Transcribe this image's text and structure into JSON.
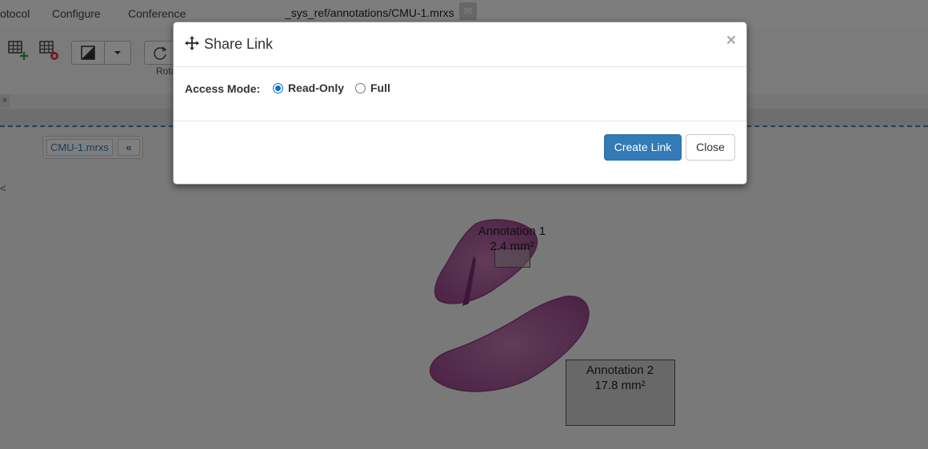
{
  "menubar": {
    "items": [
      "otocol",
      "Configure",
      "Conference"
    ],
    "filepath": "_sys_ref/annotations/CMU-1.mrxs"
  },
  "toolbar": {
    "rotate_label": "Rota"
  },
  "viewer": {
    "file_chip": "CMU-1.mrxs",
    "collapse": "«",
    "annotations": [
      {
        "name": "Annotation 1",
        "area": "2.4 mm²"
      },
      {
        "name": "Annotation 2",
        "area": "17.8 mm²"
      }
    ]
  },
  "modal": {
    "title": "Share Link",
    "close_glyph": "×",
    "access_label": "Access Mode:",
    "options": [
      {
        "label": "Read-Only",
        "checked": true
      },
      {
        "label": "Full",
        "checked": false
      }
    ],
    "create_button": "Create Link",
    "close_button": "Close"
  },
  "colors": {
    "primary": "#337ab7",
    "radio_accent": "#0b6fd3",
    "tissue": "#b05a9a"
  }
}
